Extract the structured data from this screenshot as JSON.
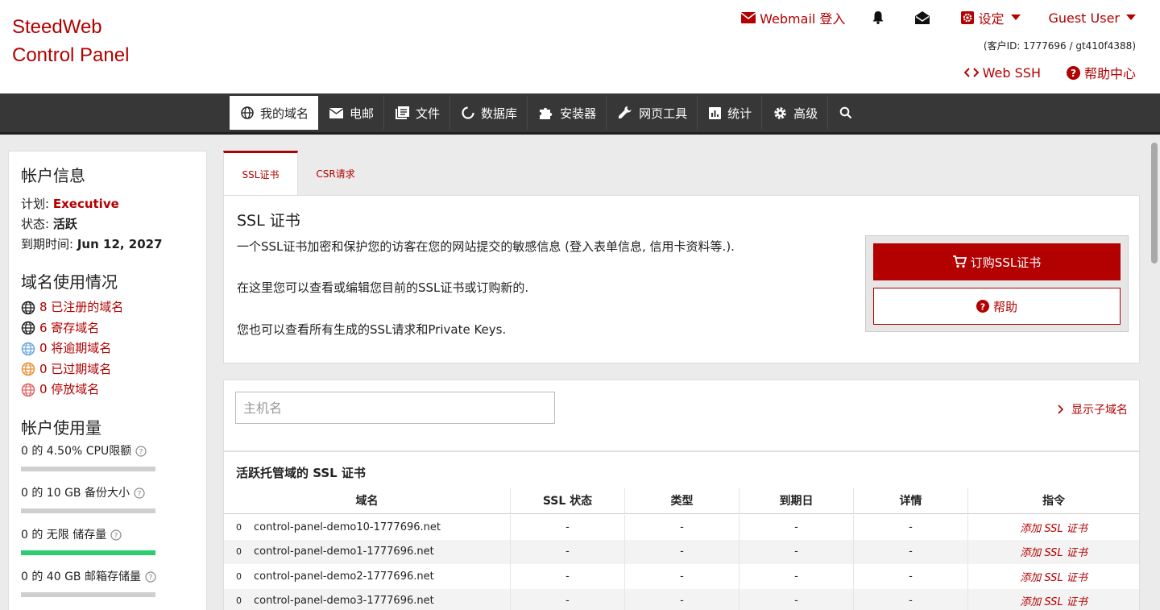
{
  "brand": {
    "line1": "SteedWeb",
    "line2": "Control Panel"
  },
  "topbar": {
    "webmail": "Webmail 登入",
    "settings": "设定",
    "user": "Guest User",
    "customer_id": "(客户ID: 1777696 / gt410f4388)",
    "web_ssh": "Web SSH",
    "help_center": "帮助中心"
  },
  "nav": {
    "items": [
      {
        "label": "我的域名",
        "icon": "globe-icon"
      },
      {
        "label": "电邮",
        "icon": "envelope-icon"
      },
      {
        "label": "文件",
        "icon": "files-icon"
      },
      {
        "label": "数据库",
        "icon": "database-icon"
      },
      {
        "label": "安装器",
        "icon": "puzzle-icon"
      },
      {
        "label": "网页工具",
        "icon": "wrench-icon"
      },
      {
        "label": "统计",
        "icon": "chart-icon"
      },
      {
        "label": "高级",
        "icon": "gear-icon"
      }
    ]
  },
  "sidebar": {
    "account_title": "帐户信息",
    "plan_label": "计划:",
    "plan_value": "Executive",
    "status_label": "状态:",
    "status_value": "活跃",
    "expiry_label": "到期时间:",
    "expiry_value": "Jun 12, 2027",
    "domains_title": "域名使用情况",
    "domain_links": [
      {
        "label": "8 已注册的域名",
        "color": "#222222"
      },
      {
        "label": "6 寄存域名",
        "color": "#222222"
      },
      {
        "label": "0 将逾期域名",
        "color": "#6fa8dc"
      },
      {
        "label": "0 已过期域名",
        "color": "#e69138"
      },
      {
        "label": "0 停放域名",
        "color": "#e06666"
      }
    ],
    "usage_title": "帐户使用量",
    "usage": [
      {
        "label": "0 的 4.50% CPU限额",
        "fill": 0
      },
      {
        "label": "0 的 10 GB 备份大小",
        "fill": 0
      },
      {
        "label": "0 的 无限 储存量",
        "fill": 1.0
      },
      {
        "label": "0 的 40 GB 邮箱存储量",
        "fill": 0
      }
    ]
  },
  "tabs": [
    {
      "label": "SSL证书"
    },
    {
      "label": "CSR请求"
    }
  ],
  "ssl_panel": {
    "title": "SSL 证书",
    "p1": "一个SSL证书加密和保护您的访客在您的网站提交的敏感信息 (登入表单信息, 信用卡资料等.).",
    "p2": "在这里您可以查看或编辑您目前的SSL证书或订购新的.",
    "p3": "您也可以查看所有生成的SSL请求和Private Keys.",
    "buy_button": "订购SSL证书",
    "help_button": "帮助"
  },
  "list_panel": {
    "search_placeholder": "主机名",
    "show_subdomains": "显示子域名",
    "table_title": "活跃托管域的 SSL 证书",
    "headers": [
      "域名",
      "SSL 状态",
      "类型",
      "到期日",
      "详情",
      "指令"
    ],
    "rows": [
      {
        "idx": "0",
        "domain": "control-panel-demo10-1777696.net",
        "ssl": "-",
        "type": "-",
        "expiry": "-",
        "details": "-",
        "action": "添加 SSL 证书"
      },
      {
        "idx": "0",
        "domain": "control-panel-demo1-1777696.net",
        "ssl": "-",
        "type": "-",
        "expiry": "-",
        "details": "-",
        "action": "添加 SSL 证书"
      },
      {
        "idx": "0",
        "domain": "control-panel-demo2-1777696.net",
        "ssl": "-",
        "type": "-",
        "expiry": "-",
        "details": "-",
        "action": "添加 SSL 证书"
      },
      {
        "idx": "0",
        "domain": "control-panel-demo3-1777696.net",
        "ssl": "-",
        "type": "-",
        "expiry": "-",
        "details": "-",
        "action": "添加 SSL 证书"
      }
    ]
  },
  "colors": {
    "brand": "#b30000",
    "nav_bg": "#373737",
    "page_bg": "#ebebeb"
  }
}
